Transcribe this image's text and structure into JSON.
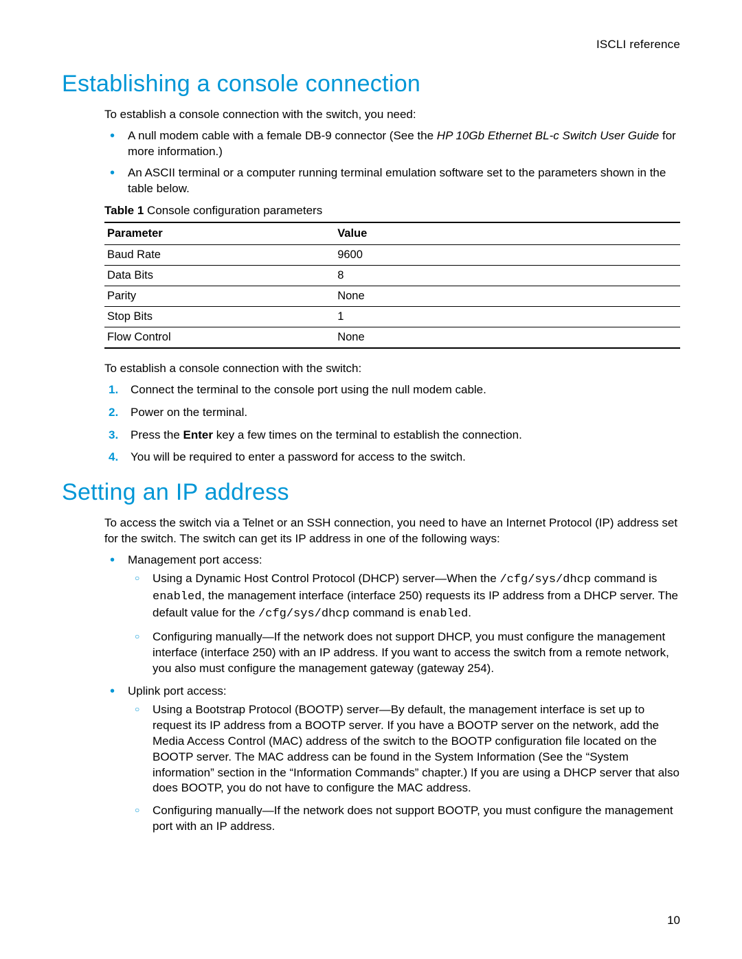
{
  "header_ref": "ISCLI reference",
  "page_number": "10",
  "section1": {
    "title": "Establishing a console connection",
    "intro": "To establish a console connection with the switch, you need:",
    "bullets": {
      "b1_prefix": "A null modem cable with a female DB-9 connector (See the ",
      "b1_italic": "HP 10Gb Ethernet BL-c Switch User Guide",
      "b1_suffix": " for more information.)",
      "b2": "An ASCII terminal or a computer running terminal emulation software set to the parameters shown in the table below."
    },
    "table_caption_label": "Table 1",
    "table_caption_text": " Console configuration parameters",
    "table_headers": {
      "param": "Parameter",
      "value": "Value"
    },
    "table_rows": [
      {
        "param": "Baud Rate",
        "value": "9600"
      },
      {
        "param": "Data Bits",
        "value": "8"
      },
      {
        "param": "Parity",
        "value": "None"
      },
      {
        "param": "Stop Bits",
        "value": "1"
      },
      {
        "param": "Flow Control",
        "value": "None"
      }
    ],
    "after_table": "To establish a console connection with the switch:",
    "steps": {
      "s1": "Connect the terminal to the console port using the null modem cable.",
      "s2": "Power on the terminal.",
      "s3_prefix": "Press the ",
      "s3_bold": "Enter",
      "s3_suffix": " key a few times on the terminal to establish the connection.",
      "s4": "You will be required to enter a password for access to the switch."
    }
  },
  "section2": {
    "title": "Setting an IP address",
    "intro": "To access the switch via a Telnet or an SSH connection, you need to have an Internet Protocol (IP) address set for the switch. The switch can get its IP address in one of the following ways:",
    "bullet1": "Management port access:",
    "sub1a_prefix": "Using a Dynamic Host Control Protocol (DHCP) server—When the ",
    "sub1a_code1": "/cfg/sys/dhcp",
    "sub1a_mid1": " command is ",
    "sub1a_code2": "enabled",
    "sub1a_mid2": ", the management interface (interface 250) requests its IP address from a DHCP server. The default value for the ",
    "sub1a_code3": "/cfg/sys/dhcp",
    "sub1a_mid3": " command is ",
    "sub1a_code4": "enabled",
    "sub1a_suffix": ".",
    "sub1b": "Configuring manually—If the network does not support DHCP, you must configure the management interface (interface 250) with an IP address. If you want to access the switch from a remote network, you also must configure the management gateway (gateway 254).",
    "bullet2": "Uplink port access:",
    "sub2a": "Using a Bootstrap Protocol (BOOTP) server—By default, the management interface is set up to request its IP address from a BOOTP server. If you have a BOOTP server on the network, add the Media Access Control (MAC) address of the switch to the BOOTP configuration file located on the BOOTP server. The MAC address can be found in the System Information (See the “System information” section in the “Information Commands” chapter.) If you are using a DHCP server that also does BOOTP, you do not have to configure the MAC address.",
    "sub2b": "Configuring manually—If the network does not support BOOTP, you must configure the management port with an IP address."
  }
}
